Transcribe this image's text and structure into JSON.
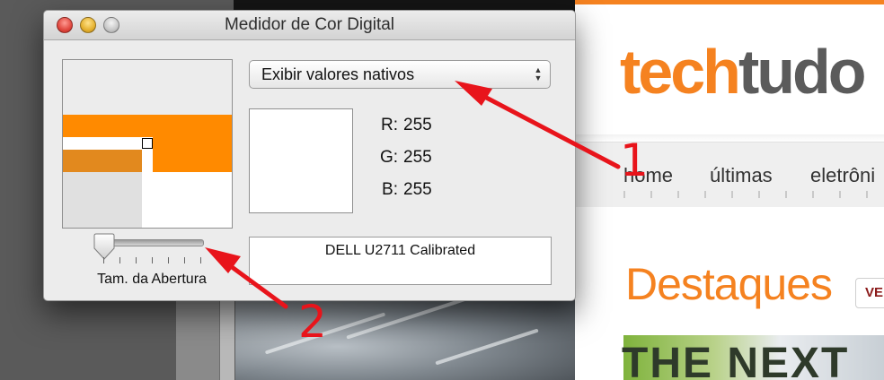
{
  "window": {
    "title": "Medidor de Cor Digital",
    "display_mode": "Exibir valores nativos",
    "color": {
      "r_label": "R:",
      "r": "255",
      "g_label": "G:",
      "g": "255",
      "b_label": "B:",
      "b": "255",
      "swatch_hex": "#ffffff"
    },
    "profile": "DELL U2711 Calibrated",
    "aperture": {
      "label": "Tam. da Abertura",
      "value": 0.0
    }
  },
  "website": {
    "logo_tech": "tech",
    "logo_tudo": "tudo",
    "nav": [
      "home",
      "últimas",
      "eletrôni"
    ],
    "section_title": "Destaques",
    "ver_button": "VE",
    "banner_text": "THE NEXT",
    "accent_color": "#f58220"
  },
  "annotations": {
    "label_1": "1",
    "label_2": "2",
    "arrow_color": "#e8141b"
  }
}
